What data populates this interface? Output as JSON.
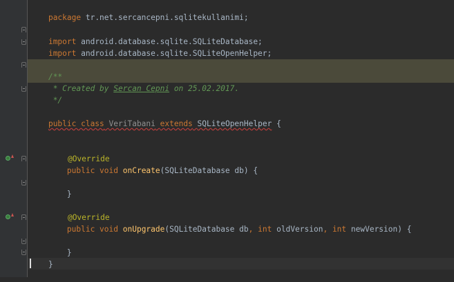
{
  "editor": {
    "line1": {
      "kw": "package",
      "rest": " tr.net.sercancepni.sqlitekullanimi;"
    },
    "line2": {
      "kw": "import",
      "rest": " android.database.sqlite.SQLiteDatabase;"
    },
    "line3": {
      "kw": "import",
      "rest": " android.database.sqlite.SQLiteOpenHelper;"
    },
    "line4": {
      "text": "/**"
    },
    "line5": {
      "pre": " * Created by ",
      "author": "Sercan Cepni",
      "mid": " on ",
      "date": "25.02.2017.",
      "post": ""
    },
    "line6": {
      "text": " */"
    },
    "line7": {
      "kw1": "public class",
      "sp1": " ",
      "cls": "VeriTabani",
      "sp2": " ",
      "kw2": "extends",
      "sp3": " ",
      "parent": "SQLiteOpenHelper",
      "tail": " {"
    },
    "line8": {
      "ann": "@Override"
    },
    "line9": {
      "indent": "    ",
      "kw": "public void",
      "sp": " ",
      "fn": "onCreate",
      "args": "(SQLiteDatabase db) {"
    },
    "line10": {
      "text": "    }"
    },
    "line11": {
      "ann": "@Override"
    },
    "line12": {
      "indent": "    ",
      "kw": "public void",
      "sp": " ",
      "fn": "onUpgrade",
      "a1": "(SQLiteDatabase db",
      "c1": ",",
      "sp1": " ",
      "k1": "int",
      "a2": " oldVersion",
      "c2": ",",
      "sp2": " ",
      "k2": "int",
      "a3": " newVersion) {"
    },
    "line13": {
      "text": "    }"
    },
    "line14": {
      "text": "}"
    }
  },
  "icons": {
    "override_marker": "override-method-icon",
    "fold_marker": "fold-icon"
  },
  "colors": {
    "background": "#2b2b2b",
    "gutter": "#313335",
    "keyword": "#cc7832",
    "annotation": "#bbb529",
    "method": "#ffc66d",
    "comment": "#629755",
    "comment_highlight": "#4b4a3a"
  }
}
